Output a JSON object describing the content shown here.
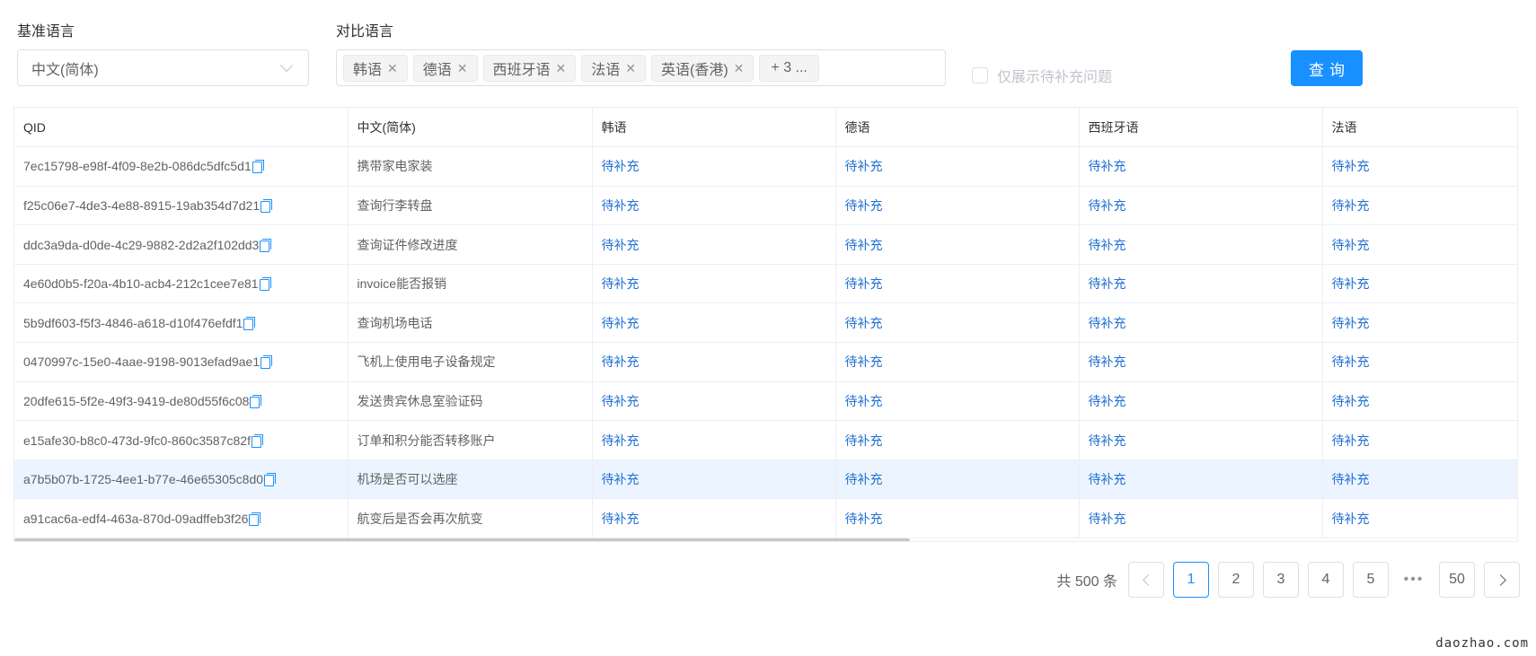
{
  "filters": {
    "base_language_label": "基准语言",
    "base_language_value": "中文(简体)",
    "compare_language_label": "对比语言",
    "compare_tags": [
      "韩语",
      "德语",
      "西班牙语",
      "法语",
      "英语(香港)"
    ],
    "compare_more": "+ 3 ...",
    "only_missing_label": "仅展示待补充问题",
    "only_missing_checked": false,
    "query_button": "查询"
  },
  "table": {
    "columns": [
      "QID",
      "中文(简体)",
      "韩语",
      "德语",
      "西班牙语",
      "法语"
    ],
    "missing_text": "待补充",
    "rows": [
      {
        "qid": "7ec15798-e98f-4f09-8e2b-086dc5dfc5d1",
        "zh": "携带家电家装"
      },
      {
        "qid": "f25c06e7-4de3-4e88-8915-19ab354d7d21",
        "zh": "查询行李转盘"
      },
      {
        "qid": "ddc3a9da-d0de-4c29-9882-2d2a2f102dd3",
        "zh": "查询证件修改进度"
      },
      {
        "qid": "4e60d0b5-f20a-4b10-acb4-212c1cee7e81",
        "zh": "invoice能否报销"
      },
      {
        "qid": "5b9df603-f5f3-4846-a618-d10f476efdf1",
        "zh": "查询机场电话"
      },
      {
        "qid": "0470997c-15e0-4aae-9198-9013efad9ae1",
        "zh": "飞机上使用电子设备规定"
      },
      {
        "qid": "20dfe615-5f2e-49f3-9419-de80d55f6c08",
        "zh": "发送贵宾休息室验证码"
      },
      {
        "qid": "e15afe30-b8c0-473d-9fc0-860c3587c82f",
        "zh": "订单和积分能否转移账户"
      },
      {
        "qid": "a7b5b07b-1725-4ee1-b77e-46e65305c8d0",
        "zh": "机场是否可以选座",
        "selected": true
      },
      {
        "qid": "a91cac6a-edf4-463a-870d-09adffeb3f26",
        "zh": "航变后是否会再次航变"
      }
    ]
  },
  "pagination": {
    "total_text": "共 500 条",
    "pages": [
      "1",
      "2",
      "3",
      "4",
      "5"
    ],
    "active_page": "1",
    "ellipsis": "•••",
    "last_page": "50"
  },
  "watermark": "daozhao.com",
  "colors": {
    "primary": "#1890ff",
    "link": "#1f6fd1",
    "selected_row": "#ecf5ff",
    "border": "#ebeef5"
  }
}
